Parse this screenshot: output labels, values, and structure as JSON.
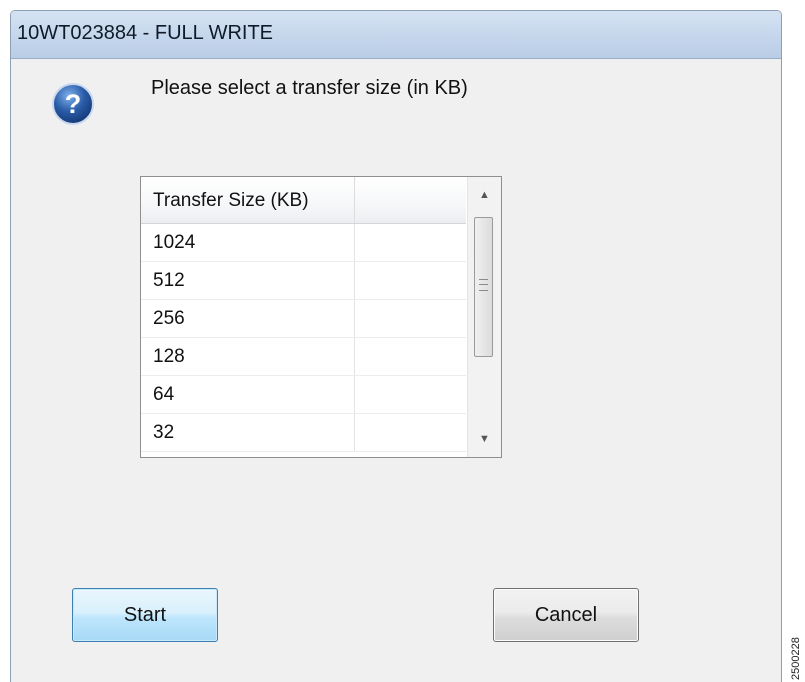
{
  "window": {
    "title": "10WT023884 - FULL WRITE"
  },
  "dialog": {
    "icon": "question-icon",
    "prompt": "Please select a transfer size (in KB)"
  },
  "list": {
    "columns": [
      "Transfer Size (KB)",
      ""
    ],
    "rows": [
      "1024",
      "512",
      "256",
      "128",
      "64",
      "32"
    ],
    "scrollbar": {
      "up_icon": "scroll-up-icon",
      "down_icon": "scroll-down-icon"
    }
  },
  "buttons": {
    "start_label": "Start",
    "cancel_label": "Cancel"
  },
  "figure_id": "2500228",
  "colors": {
    "titlebar": "#c6d7ec",
    "start_button": "#bee6fd",
    "dialog_bg": "#f0f0f0",
    "question_icon": "#2a5ca8"
  }
}
